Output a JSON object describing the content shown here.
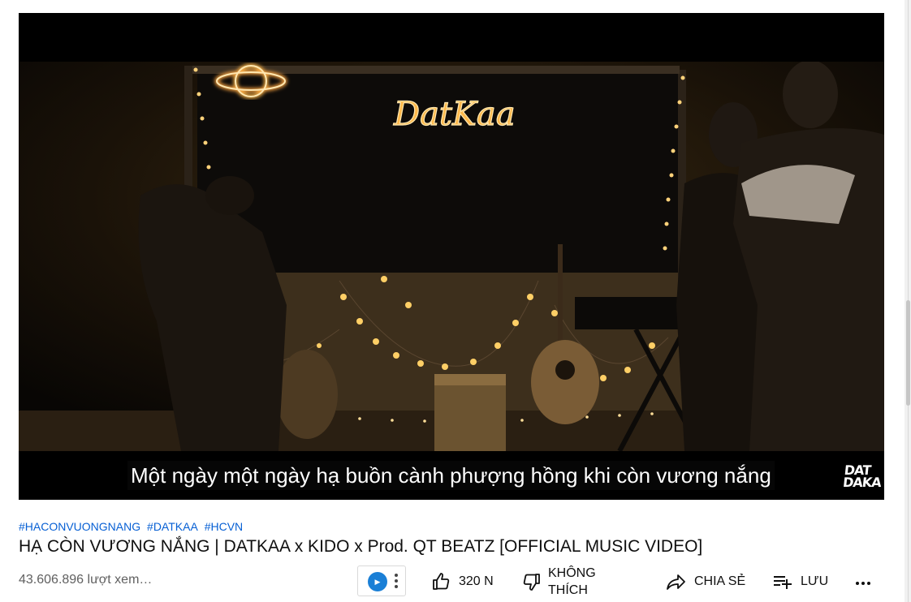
{
  "video": {
    "subtitle": "Một ngày một ngày hạ buồn cành phượng hồng khi còn vương nắng",
    "watermark_line1": "DAT",
    "watermark_line2": "DAKA",
    "neon_sign": "DatKaa"
  },
  "info": {
    "hashtags": [
      "#HACONVUONGNANG",
      "#DATKAA",
      "#HCVN"
    ],
    "title": "HẠ CÒN VƯƠNG NẮNG | DATKAA x KIDO x Prod. QT BEATZ [OFFICIAL MUSIC VIDEO]",
    "views": "43.606.896 lượt xem…"
  },
  "actions": {
    "like_count": "320 N",
    "dislike_label": "KHÔNG THÍCH",
    "share_label": "CHIA SẺ",
    "save_label": "LƯU"
  },
  "icons": {
    "like": "thumbs-up-icon",
    "dislike": "thumbs-down-icon",
    "share": "share-arrow-icon",
    "save": "playlist-add-icon",
    "more": "more-horizontal-icon",
    "channel": "channel-logo-icon"
  },
  "colors": {
    "link": "#065fd4",
    "text": "#0f0f0f",
    "secondary": "#606060",
    "neon": "#ffb84a"
  }
}
